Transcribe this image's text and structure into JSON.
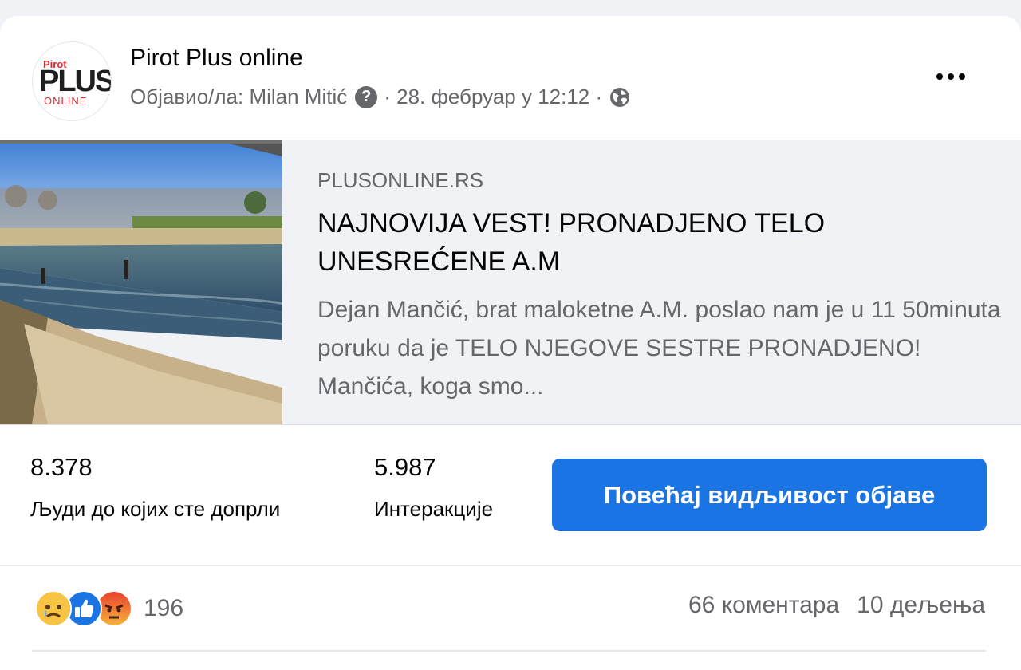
{
  "post": {
    "page_name": "Pirot Plus online",
    "avatar": {
      "line1": "Pirot",
      "line2": "PLUS",
      "line3": "ONLINE"
    },
    "published_by": "Објавио/ла: Milan Mitić",
    "date": "· 28. фебруар у 12:12 ·",
    "info_icon": "question-circle-icon",
    "privacy_icon": "globe-icon",
    "more_icon": "more-horizontal-icon"
  },
  "link": {
    "domain": "PLUSONLINE.RS",
    "headline": "NAJNOVIJA VEST! PRONADJENO TELO UNESREĆENE A.M",
    "description": "Dejan Mančić, brat maloketne A.M. poslao nam je u 11 50minuta poruku da je TELO NJEGOVE SESTRE PRONADJENO! Mančića, koga smo..."
  },
  "stats": {
    "reach_value": "8.378",
    "reach_label": "Људи до којих сте допрли",
    "engagement_value": "5.987",
    "engagement_label": "Интеракције",
    "boost_label": "Повећај видљивост објаве"
  },
  "footer": {
    "reactions": [
      "sad-face-icon",
      "like-icon",
      "angry-face-icon"
    ],
    "reaction_count": "196",
    "comments": "66 коментара",
    "shares": "10 дељења"
  },
  "colors": {
    "accent": "#1b74e4",
    "secondary_text": "#65676b"
  }
}
